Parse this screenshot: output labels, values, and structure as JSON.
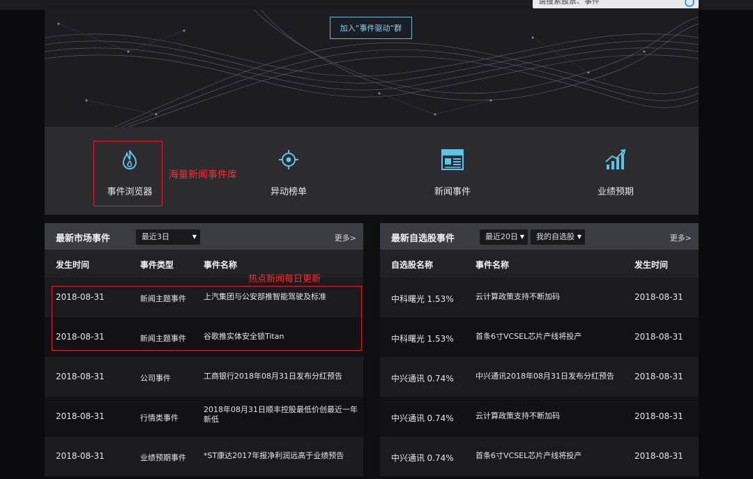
{
  "nav": {
    "search_placeholder": "请搜索股票、事件"
  },
  "banner": {
    "join_button": "加入“事件驱动”群"
  },
  "features": [
    {
      "label": "事件浏览器",
      "icon": "flame-icon"
    },
    {
      "label": "异动榜单",
      "icon": "crosshair-icon"
    },
    {
      "label": "新闻事件",
      "icon": "news-icon"
    },
    {
      "label": "业绩预期",
      "icon": "chart-growth-icon"
    }
  ],
  "annotations": {
    "feature_note": "海量新闻事件库",
    "table_note": "热点新闻每日更新"
  },
  "market_panel": {
    "title": "最新市场事件",
    "range_select": "最近3日",
    "more": "更多>",
    "columns": [
      "发生时间",
      "事件类型",
      "事件名称"
    ],
    "rows": [
      {
        "date": "2018-08-31",
        "type": "新闻主题事件",
        "name": "上汽集团与公安部推智能驾驶及标准"
      },
      {
        "date": "2018-08-31",
        "type": "新闻主题事件",
        "name": "谷歌推实体安全锁Titan"
      },
      {
        "date": "2018-08-31",
        "type": "公司事件",
        "name": "工商银行2018年08月31日发布分红预告"
      },
      {
        "date": "2018-08-31",
        "type": "行情类事件",
        "name": "2018年08月31日顺丰控股最低价创最近一年新低"
      },
      {
        "date": "2018-08-31",
        "type": "业绩预期事件",
        "name": "*ST康达2017年报净利润远高于业绩预告"
      }
    ]
  },
  "watch_panel": {
    "title": "最新自选股事件",
    "range_select": "最近20日",
    "list_select": "我的自选股",
    "more": "更多>",
    "columns": [
      "自选股名称",
      "事件名称",
      "发生时间"
    ],
    "rows": [
      {
        "stock": "中科曙光",
        "change": "1.53%",
        "name": "云计算政策支持不断加码",
        "date": "2018-08-31"
      },
      {
        "stock": "中科曙光",
        "change": "1.53%",
        "name": "首条6寸VCSEL芯片产线将投产",
        "date": "2018-08-31"
      },
      {
        "stock": "中兴通讯",
        "change": "0.74%",
        "name": "中兴通讯2018年08月31日发布分红预告",
        "date": "2018-08-31"
      },
      {
        "stock": "中兴通讯",
        "change": "0.74%",
        "name": "云计算政策支持不断加码",
        "date": "2018-08-31"
      },
      {
        "stock": "中兴通讯",
        "change": "0.74%",
        "name": "首条6寸VCSEL芯片产线将投产",
        "date": "2018-08-31"
      }
    ]
  },
  "colors": {
    "accent": "#5ec3e6",
    "annotation": "#e02020",
    "positive": "#ff3b3b"
  }
}
